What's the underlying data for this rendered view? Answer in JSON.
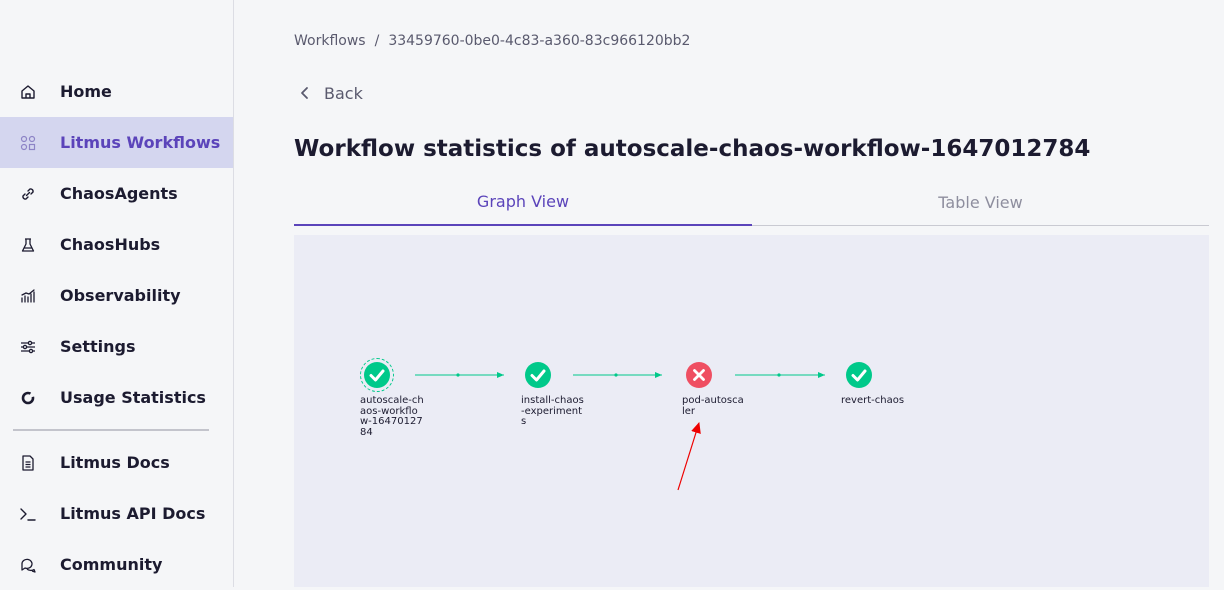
{
  "sidebar": {
    "items": [
      {
        "label": "Home",
        "icon": "home-icon",
        "active": false
      },
      {
        "label": "Litmus Workflows",
        "icon": "workflows-icon",
        "active": true
      },
      {
        "label": "ChaosAgents",
        "icon": "link-icon",
        "active": false
      },
      {
        "label": "ChaosHubs",
        "icon": "flask-icon",
        "active": false
      },
      {
        "label": "Observability",
        "icon": "chart-icon",
        "active": false
      },
      {
        "label": "Settings",
        "icon": "sliders-icon",
        "active": false
      },
      {
        "label": "Usage Statistics",
        "icon": "ring-icon",
        "active": false
      }
    ],
    "secondary": [
      {
        "label": "Litmus Docs",
        "icon": "document-icon"
      },
      {
        "label": "Litmus API Docs",
        "icon": "terminal-icon"
      },
      {
        "label": "Community",
        "icon": "chat-icon"
      }
    ]
  },
  "breadcrumb": {
    "root": "Workflows",
    "separator": "/",
    "current": "33459760-0be0-4c83-a360-83c966120bb2"
  },
  "back_label": "Back",
  "title": "Workflow statistics of autoscale-chaos-workflow-1647012784",
  "tabs": [
    {
      "label": "Graph View",
      "active": true
    },
    {
      "label": "Table View",
      "active": false
    }
  ],
  "graph": {
    "nodes": [
      {
        "label": "autoscale-chaos-workflow-1647012784",
        "status": "succeeded",
        "root": true
      },
      {
        "label": "install-chaos-experiments",
        "status": "succeeded"
      },
      {
        "label": "pod-autoscaler",
        "status": "failed"
      },
      {
        "label": "revert-chaos",
        "status": "succeeded"
      }
    ]
  },
  "colors": {
    "accent": "#5b44ba",
    "success": "#00c98a",
    "failed": "#ef4f62",
    "annotation_arrow": "#ee0000"
  }
}
